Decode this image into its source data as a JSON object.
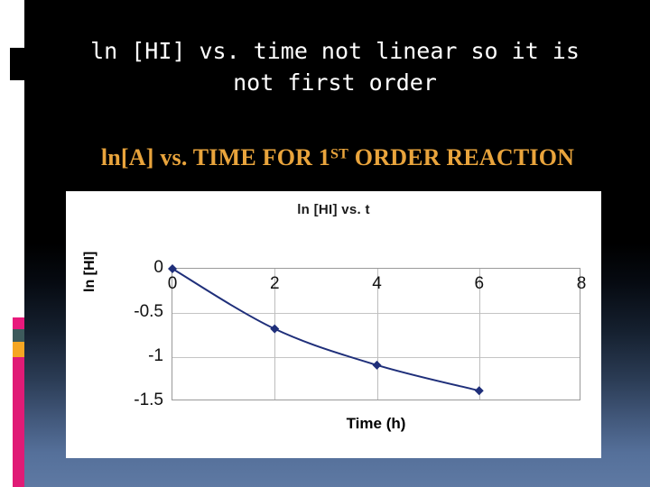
{
  "slide": {
    "headline": "ln [HI] vs. time not linear so it is\nnot first order",
    "subhead_prefix": "ln[A] vs. TIME FOR 1",
    "subhead_sup": "ST",
    "subhead_suffix": " ORDER REACTION",
    "accent_gold": "#E9A43C",
    "accent_pink": "#E01B76",
    "accent_teal": "#3D5A5C",
    "background_top": "#000000",
    "background_bottom": "#5E79A3"
  },
  "chart_data": {
    "type": "line",
    "title": "ln [HI] vs. t",
    "xlabel": "Time (h)",
    "ylabel": "ln [HI]",
    "x": [
      0,
      2,
      4,
      6
    ],
    "values": [
      0,
      -0.68,
      -1.09,
      -1.38
    ],
    "xticks": [
      0,
      2,
      4,
      6,
      8
    ],
    "xtick_labels": [
      "0",
      "2",
      "4",
      "6",
      "8"
    ],
    "yticks": [
      0,
      -0.5,
      -1,
      -1.5
    ],
    "ytick_labels": [
      "0",
      "-0.5",
      "-1",
      "-1.5"
    ],
    "xlim": [
      0,
      8
    ],
    "ylim": [
      -1.5,
      0
    ],
    "grid": true,
    "legend": false,
    "series_color": "#1F2F7A",
    "marker": "diamond",
    "marker_color": "#1F2F7A"
  }
}
